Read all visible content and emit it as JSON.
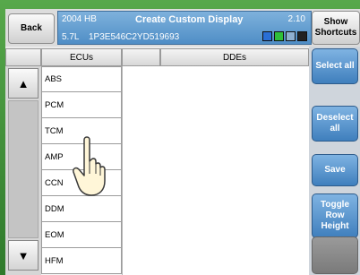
{
  "header": {
    "back_label": "Back",
    "vehicle": "2004 HB",
    "title": "Create Custom Display",
    "version": "2.10",
    "engine": "5.7L",
    "vin": "1P3E546C2YD519693",
    "show_shortcuts_label": "Show Shortcuts",
    "status_icon_colors": [
      "#2a6fd6",
      "#2fbf3a",
      "#8fb0d0",
      "#222222"
    ]
  },
  "table": {
    "ecus_header": "ECUs",
    "ddes_header": "DDEs",
    "ecus": [
      "ABS",
      "PCM",
      "TCM",
      "AMP",
      "CCN",
      "DDM",
      "EOM",
      "HFM"
    ]
  },
  "scroll": {
    "up_icon": "▲",
    "down_icon": "▼"
  },
  "sidebar": {
    "select_all": "Select all",
    "deselect_all": "Deselect all",
    "save": "Save",
    "toggle_row_height": "Toggle Row Height"
  }
}
